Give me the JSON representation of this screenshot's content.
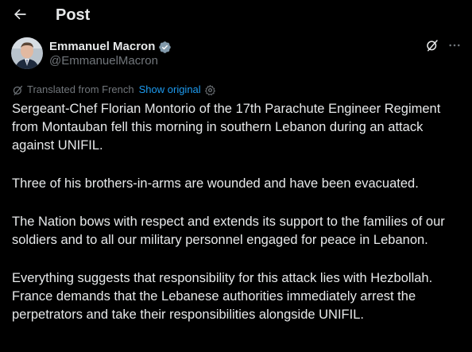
{
  "header": {
    "title": "Post"
  },
  "author": {
    "name": "Emmanuel Macron",
    "handle": "@EmmanuelMacron"
  },
  "translation": {
    "label": "Translated from French",
    "show_original": "Show original"
  },
  "post": {
    "paragraphs": [
      "Sergeant-Chef Florian Montorio of the 17th Parachute Engineer Regiment from Montauban fell this morning in southern Lebanon during an attack against UNIFIL.",
      "Three of his brothers-in-arms are wounded and have been evacuated.",
      "The Nation bows with respect and extends its support to the families of our soldiers and to all our military personnel engaged for peace in Lebanon.",
      "Everything suggests that responsibility for this attack lies with Hezbollah. France demands that the Lebanese authorities immediately arrest the perpetrators and take their responsibilities alongside UNIFIL."
    ]
  },
  "colors": {
    "background": "#000000",
    "text_primary": "#e7e9ea",
    "text_secondary": "#71767b",
    "accent": "#1d9bf0"
  },
  "icons": {
    "back": "arrow-left-icon",
    "verified": "verified-badge-icon",
    "grok": "grok-icon",
    "more": "more-icon",
    "translate": "translate-icon",
    "settings": "gear-icon"
  }
}
